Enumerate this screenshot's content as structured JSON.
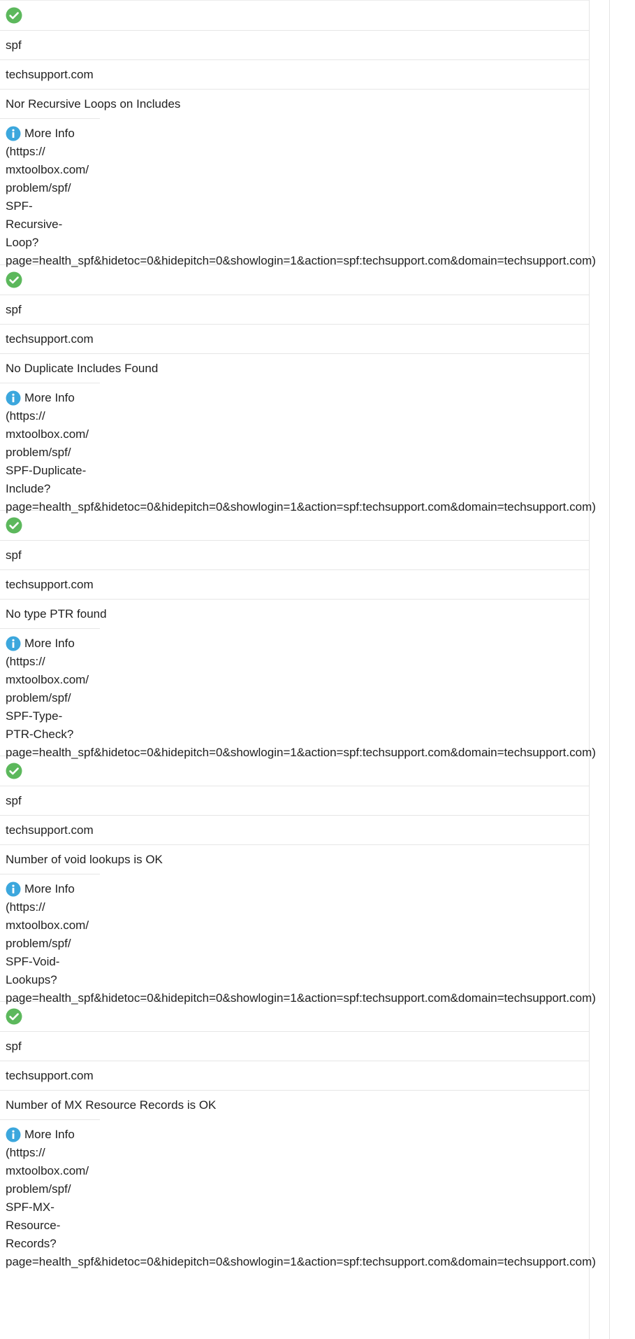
{
  "records": [
    {
      "status_icon": "check-circle-icon",
      "type": "spf",
      "domain": "techsupport.com",
      "description": "Nor Recursive Loops on Includes",
      "more_info_label": "More Info",
      "url_lines": [
        "(https://",
        "mxtoolbox.com/",
        "problem/spf/",
        "SPF-",
        "Recursive-",
        "Loop?",
        "page=health_spf&hidetoc=0&hidepitch=0&showlogin=1&action=spf:techsupport.com&domain=techsupport.com)"
      ]
    },
    {
      "status_icon": "check-circle-icon",
      "type": "spf",
      "domain": "techsupport.com",
      "description": "No Duplicate Includes Found",
      "more_info_label": "More Info",
      "url_lines": [
        "(https://",
        "mxtoolbox.com/",
        "problem/spf/",
        "SPF-Duplicate-",
        "Include?",
        "page=health_spf&hidetoc=0&hidepitch=0&showlogin=1&action=spf:techsupport.com&domain=techsupport.com)"
      ]
    },
    {
      "status_icon": "check-circle-icon",
      "type": "spf",
      "domain": "techsupport.com",
      "description": "No type PTR found",
      "more_info_label": "More Info",
      "url_lines": [
        "(https://",
        "mxtoolbox.com/",
        "problem/spf/",
        "SPF-Type-",
        "PTR-Check?",
        "page=health_spf&hidetoc=0&hidepitch=0&showlogin=1&action=spf:techsupport.com&domain=techsupport.com)"
      ]
    },
    {
      "status_icon": "check-circle-icon",
      "type": "spf",
      "domain": "techsupport.com",
      "description": "Number of void lookups is OK",
      "more_info_label": "More Info",
      "url_lines": [
        "(https://",
        "mxtoolbox.com/",
        "problem/spf/",
        "SPF-Void-",
        "Lookups?",
        "page=health_spf&hidetoc=0&hidepitch=0&showlogin=1&action=spf:techsupport.com&domain=techsupport.com)"
      ]
    },
    {
      "status_icon": "check-circle-icon",
      "type": "spf",
      "domain": "techsupport.com",
      "description": "Number of MX Resource Records is OK",
      "more_info_label": "More Info",
      "url_lines": [
        "(https://",
        "mxtoolbox.com/",
        "problem/spf/",
        "SPF-MX-",
        "Resource-",
        "Records?",
        "page=health_spf&hidetoc=0&hidepitch=0&showlogin=1&action=spf:techsupport.com&domain=techsupport.com)"
      ]
    }
  ],
  "colors": {
    "check_green": "#5cb85c",
    "info_blue": "#3ca7dd",
    "row_border": "#e6e6e6",
    "text": "#1f1f1f"
  }
}
